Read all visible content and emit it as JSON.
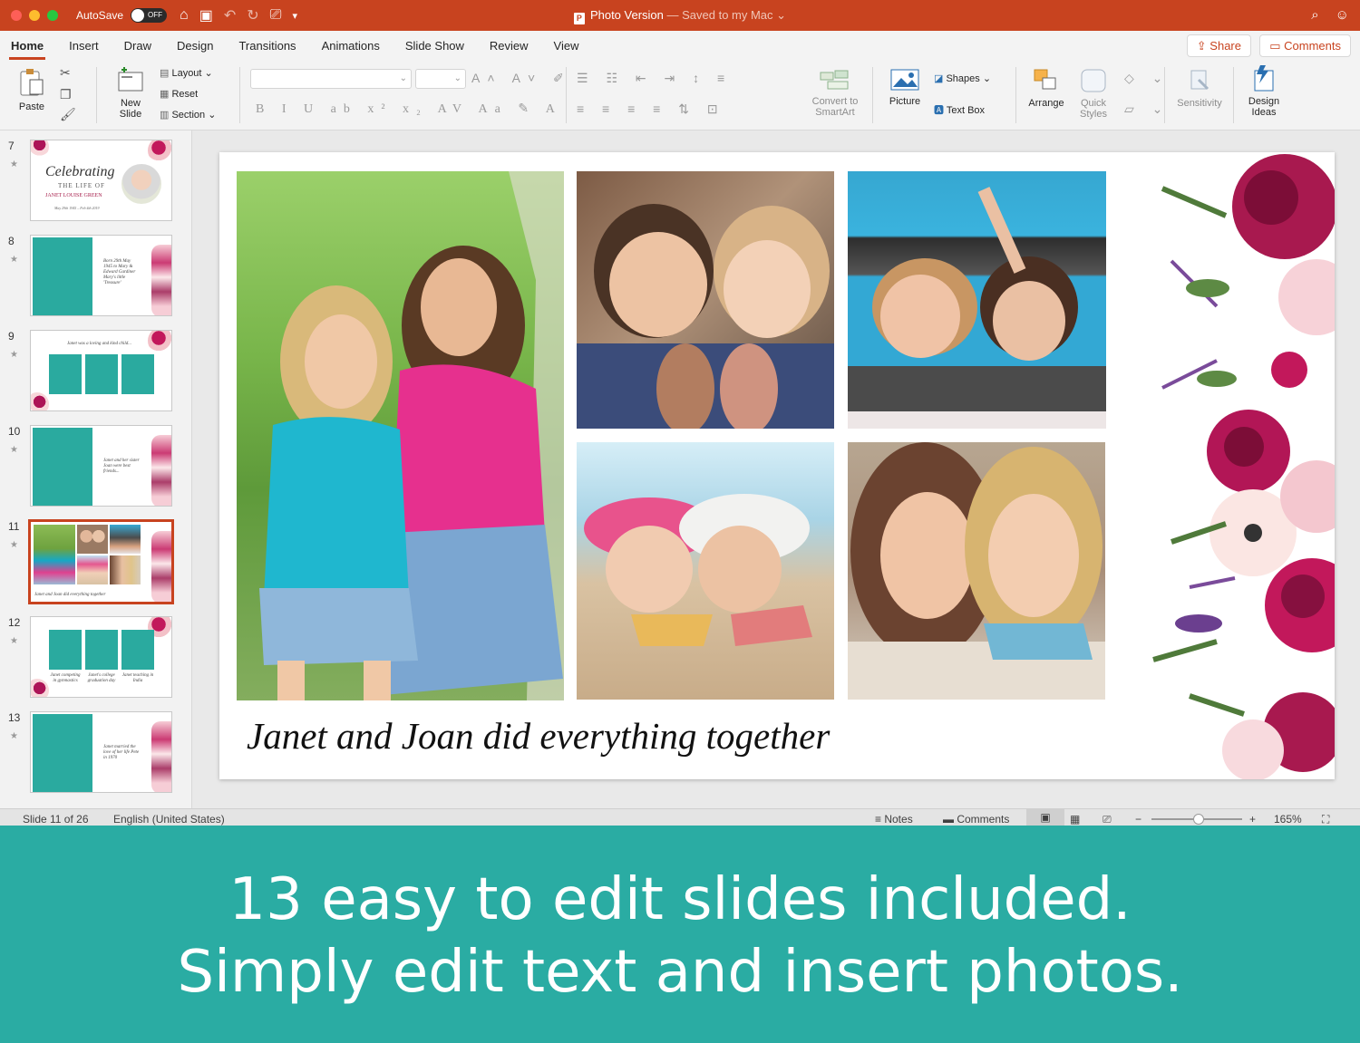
{
  "window": {
    "autosave_label": "AutoSave",
    "autosave_state": "OFF",
    "doc_name": "Photo Version",
    "doc_status": " — Saved to my Mac ",
    "chevron": "⌄"
  },
  "ribbon_tabs": [
    "Home",
    "Insert",
    "Draw",
    "Design",
    "Transitions",
    "Animations",
    "Slide Show",
    "Review",
    "View"
  ],
  "actions": {
    "share": "Share",
    "comments": "Comments"
  },
  "ribbon": {
    "paste": "Paste",
    "new_slide": "New Slide",
    "layout": "Layout",
    "reset": "Reset",
    "section": "Section",
    "convert": "Convert to SmartArt",
    "picture": "Picture",
    "shapes": "Shapes",
    "text_box": "Text Box",
    "arrange": "Arrange",
    "quick_styles": "Quick Styles",
    "sensitivity": "Sensitivity",
    "design_ideas": "Design Ideas"
  },
  "thumbnails": [
    {
      "num": "7",
      "title": "Celebrating",
      "sub": "THE LIFE OF",
      "name": "JANET LOUISE GREEN",
      "dates": "May 29th 1945 – Feb 4th 2019"
    },
    {
      "num": "8",
      "text": "Born 29th May 1945 to Mary & Edward Gardiner  Mary's little 'Treasure'"
    },
    {
      "num": "9",
      "text": "Janet was a loving and kind child..."
    },
    {
      "num": "10",
      "text": "Janet and her sister Joan were best friends..."
    },
    {
      "num": "11",
      "text": "Janet and Joan did everything together"
    },
    {
      "num": "12",
      "cap1": "Janet competing in gymnastics",
      "cap2": "Janet's college graduation day",
      "cap3": "Janet teaching in India"
    },
    {
      "num": "13",
      "text": "Janet married the love of her life Pete in 1970"
    }
  ],
  "slide": {
    "caption": "Janet and Joan did everything together"
  },
  "status": {
    "slide_pos": "Slide 11 of 26",
    "language": "English (United States)",
    "notes": "Notes",
    "comments": "Comments",
    "zoom": "165%",
    "zoom_level_pct": 52
  },
  "banner": {
    "line1": "13 easy to edit slides included.",
    "line2": "Simply edit text and insert photos."
  },
  "colors": {
    "accent": "#c8431f",
    "teal": "#2aaca3"
  }
}
